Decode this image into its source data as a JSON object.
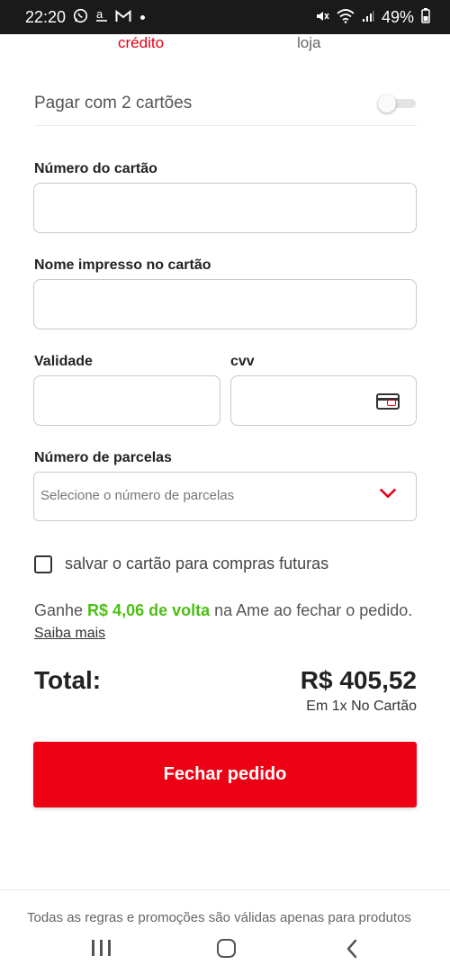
{
  "status_bar": {
    "time": "22:20",
    "notification_icons": [
      "whatsapp-icon",
      "amazon-icon",
      "gmail-icon"
    ],
    "battery": "49%"
  },
  "tabs": {
    "credito": "crédito",
    "loja": "loja"
  },
  "two_cards": {
    "label": "Pagar com 2 cartões",
    "enabled": false
  },
  "form": {
    "card_number_label": "Número do cartão",
    "card_number_value": "",
    "name_label": "Nome impresso no cartão",
    "name_value": "",
    "expiry_label": "Validade",
    "expiry_value": "",
    "cvv_label": "cvv",
    "cvv_value": "",
    "installments_label": "Número de parcelas",
    "installments_placeholder": "Selecione o número de parcelas"
  },
  "save_card": {
    "label": "salvar o cartão para compras futuras",
    "checked": false
  },
  "cashback": {
    "prefix": "Ganhe ",
    "amount": "R$ 4,06 de volta",
    "suffix": " na Ame ao fechar o pedido. ",
    "link": "Saiba mais"
  },
  "total": {
    "label": "Total:",
    "value": "R$ 405,52",
    "subtitle": "Em 1x No Cartão"
  },
  "primary_button": {
    "label": "Fechar pedido"
  },
  "footer": {
    "text": "Todas as regras e promoções são válidas apenas para produtos"
  },
  "colors": {
    "accent": "#ee0014",
    "cashback_green": "#4cbf15"
  }
}
